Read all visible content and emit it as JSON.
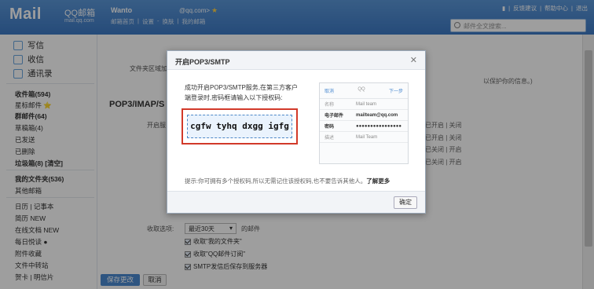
{
  "header": {
    "logo": "Mail",
    "logo_sub": "QQ邮箱",
    "logo_domain": "mail.qq.com",
    "user_name": "Wanto",
    "user_email": "@qq.com>",
    "links": [
      "邮箱首页",
      "|",
      "设置",
      "-",
      "换肤",
      "|",
      "我的邮箱"
    ],
    "top_links": [
      "反馈建议",
      "|",
      "帮助中心",
      "|",
      "退出"
    ],
    "search_placeholder": "邮件全文搜索..."
  },
  "sidebar": {
    "tools": [
      {
        "label": "写信",
        "icon": "compose-icon"
      },
      {
        "label": "收信",
        "icon": "inbox-icon"
      },
      {
        "label": "通讯录",
        "icon": "contacts-icon"
      }
    ],
    "folders": [
      {
        "label": "收件箱(594)",
        "strong": true
      },
      {
        "label": "星标邮件 ⭐"
      },
      {
        "label": "群邮件(64)",
        "strong": true
      },
      {
        "label": "草稿箱(4)"
      },
      {
        "label": "已发送"
      },
      {
        "label": "已删除"
      },
      {
        "label": "垃圾箱(8) [清空]",
        "strong": true
      },
      {
        "label": "我的文件夹(536)",
        "strong": true
      },
      {
        "label": "其他邮箱"
      },
      {
        "label": "日历 | 记事本"
      },
      {
        "label": "简历 NEW"
      },
      {
        "label": "在线文档 NEW"
      },
      {
        "label": "每日悦读 ●"
      },
      {
        "label": "附件收藏"
      },
      {
        "label": "文件中转站"
      },
      {
        "label": "贺卡 | 明信片"
      }
    ]
  },
  "main": {
    "section_title": "POP3/IMAP/S",
    "row_file": "文件夹区域加",
    "row_open": "开启服",
    "opts": [
      [
        "已开启",
        "|",
        "关闭"
      ],
      [
        "已开启",
        "|",
        "关闭"
      ],
      [
        "已关闭",
        "|",
        "开启"
      ],
      [
        "已关闭",
        "|",
        "开启"
      ]
    ],
    "tip_right": "以保护你的信息。)",
    "recv_label": "收取选项:",
    "recv_select": "最近30天",
    "recv_suffix": "的邮件",
    "checks": [
      "收取\"我的文件夹\"",
      "收取\"QQ邮件订阅\"",
      "SMTP发信后保存到服务器"
    ],
    "save_label": "保存更改",
    "cancel_label": "取消"
  },
  "dialog": {
    "title": "开启POP3/SMTP",
    "desc": "成功开启POP3/SMTP服务,在第三方客户端登录时,密码框请输入以下授权码:",
    "code": "cgfw tyhq dxgg igfg",
    "phone": {
      "left": "取消",
      "center": "QQ",
      "right": "下一步",
      "rows": [
        {
          "k": "名称",
          "v": "Mail team",
          "bold": false
        },
        {
          "k": "电子邮件",
          "v": "mailteam@qq.com",
          "bold": true
        },
        {
          "k": "密码",
          "v": "●●●●●●●●●●●●●●●●",
          "bold": true
        },
        {
          "k": "描述",
          "v": "Mail Team",
          "bold": false
        }
      ]
    },
    "hint": "提示:你可拥有多个授权码,所以无需记住该授权码,也不要告诉其他人。",
    "hint_link": "了解更多",
    "ok_label": "确定"
  }
}
